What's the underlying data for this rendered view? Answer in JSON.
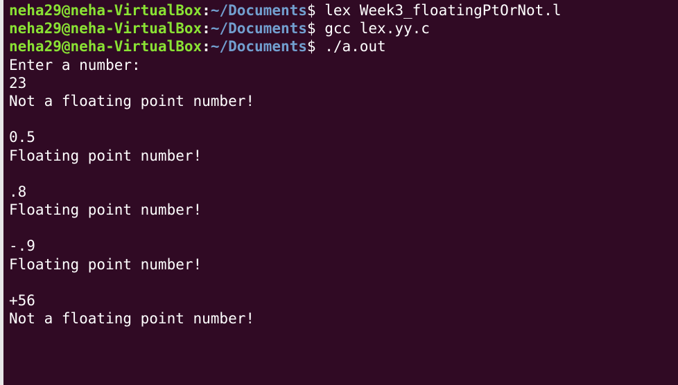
{
  "terminal": {
    "prompt": {
      "user_host": "neha29@neha-VirtualBox",
      "separator": ":",
      "path": "~/Documents",
      "symbol": "$"
    },
    "commands": [
      "lex Week3_floatingPtOrNot.l",
      "gcc lex.yy.c",
      "./a.out"
    ],
    "output_lines": [
      "Enter a number:",
      "23",
      "Not a floating point number!",
      "",
      "0.5",
      "Floating point number!",
      "",
      ".8",
      "Floating point number!",
      "",
      "-.9",
      "Floating point number!",
      "",
      "+56",
      "Not a floating point number!"
    ]
  }
}
